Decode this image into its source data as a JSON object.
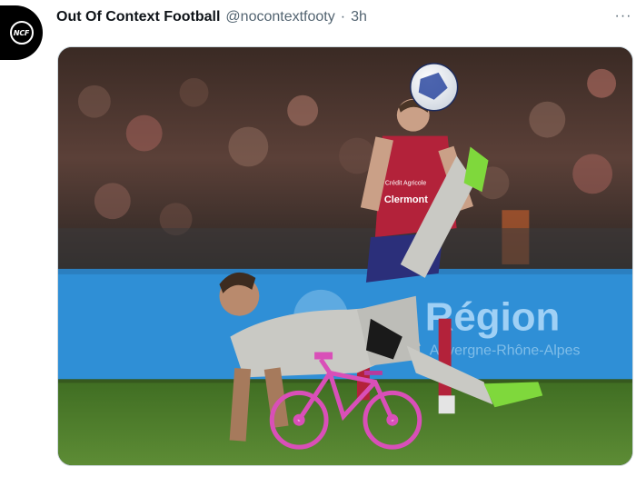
{
  "tweet": {
    "avatar_text": "NCF",
    "display_name": "Out Of Context Football",
    "handle": "@nocontextfooty",
    "separator": "·",
    "time": "3h",
    "more_icon": "more-horizontal-icon"
  },
  "media": {
    "ad_board_text": "Région",
    "ad_board_subtext": "Auvergne-Rhône-Alpes",
    "shirt_sponsor_top": "Crédit Agricole",
    "shirt_sponsor_main": "Clermont",
    "colors": {
      "pitch": "#4f7d2c",
      "ad_board": "#2f8fd6",
      "red_shirt": "#b3223a",
      "grey_kit": "#c9c9c4",
      "bike": "#d94fb8",
      "boots": "#7fd83c"
    }
  }
}
